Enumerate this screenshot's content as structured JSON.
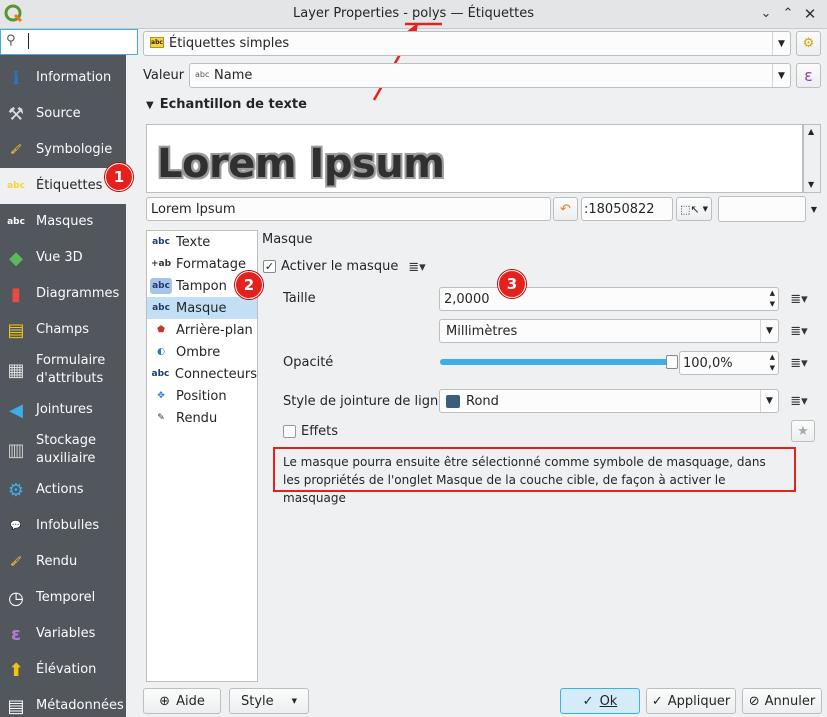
{
  "window": {
    "title": "Layer Properties - polys — Étiquettes"
  },
  "search": {
    "value": "",
    "placeholder": ""
  },
  "sidebar": {
    "items": [
      {
        "label": "Information",
        "icon": "info-icon"
      },
      {
        "label": "Source",
        "icon": "source-icon"
      },
      {
        "label": "Symbologie",
        "icon": "symbology-icon"
      },
      {
        "label": "Étiquettes",
        "icon": "labels-icon"
      },
      {
        "label": "Masques",
        "icon": "masks-icon"
      },
      {
        "label": "Vue 3D",
        "icon": "view3d-icon"
      },
      {
        "label": "Diagrammes",
        "icon": "diagram-icon"
      },
      {
        "label": "Champs",
        "icon": "fields-icon"
      },
      {
        "label": "Formulaire d'attributs",
        "icon": "form-icon"
      },
      {
        "label": "Jointures",
        "icon": "joins-icon"
      },
      {
        "label": "Stockage auxiliaire",
        "icon": "storage-icon"
      },
      {
        "label": "Actions",
        "icon": "actions-icon"
      },
      {
        "label": "Infobulles",
        "icon": "tooltip-icon"
      },
      {
        "label": "Rendu",
        "icon": "rendering-icon"
      },
      {
        "label": "Temporel",
        "icon": "clock-icon"
      },
      {
        "label": "Variables",
        "icon": "epsilon-icon"
      },
      {
        "label": "Élévation",
        "icon": "elevation-icon"
      },
      {
        "label": "Métadonnées",
        "icon": "metadata-icon"
      }
    ]
  },
  "labels_mode": {
    "value": "Étiquettes simples"
  },
  "value_row": {
    "label": "Valeur",
    "field": "Name",
    "expr_symbol": "ε"
  },
  "sample": {
    "section_title": "Echantillon de texte",
    "preview_text": "Lorem Ipsum",
    "text_value": "Lorem Ipsum",
    "scale_value": ":18050822"
  },
  "subtabs": [
    {
      "label": "Texte",
      "icon": "abc"
    },
    {
      "label": "Formatage",
      "icon": "+ab"
    },
    {
      "label": "Tampon",
      "icon": "abc"
    },
    {
      "label": "Masque",
      "icon": "abc"
    },
    {
      "label": "Arrière-plan",
      "icon": "shield"
    },
    {
      "label": "Ombre",
      "icon": "shadow"
    },
    {
      "label": "Connecteurs",
      "icon": "abc"
    },
    {
      "label": "Position",
      "icon": "move"
    },
    {
      "label": "Rendu",
      "icon": "brush"
    }
  ],
  "mask": {
    "section_title": "Masque",
    "enable_label": "Activer le masque",
    "enable_checked": true,
    "size_label": "Taille",
    "size_value": "2,0000",
    "unit_value": "Millimètres",
    "opacity_label": "Opacité",
    "opacity_value": "100,0%",
    "opacity_fraction": 1.0,
    "join_label": "Style de jointure de ligne",
    "join_value": "Rond",
    "effects_label": "Effets",
    "info_text": "Le masque pourra ensuite être sélectionné comme symbole de masquage, dans les propriétés de l'onglet Masque de la couche cible, de façon à activer le masquage"
  },
  "badges": [
    "1",
    "2",
    "3"
  ],
  "footer": {
    "help": "Aide",
    "style": "Style",
    "ok": "Ok",
    "apply": "Appliquer",
    "cancel": "Annuler"
  },
  "colors": {
    "accent": "#3daee9",
    "badge": "#e5211d",
    "sidebar_bg": "#52575d"
  }
}
